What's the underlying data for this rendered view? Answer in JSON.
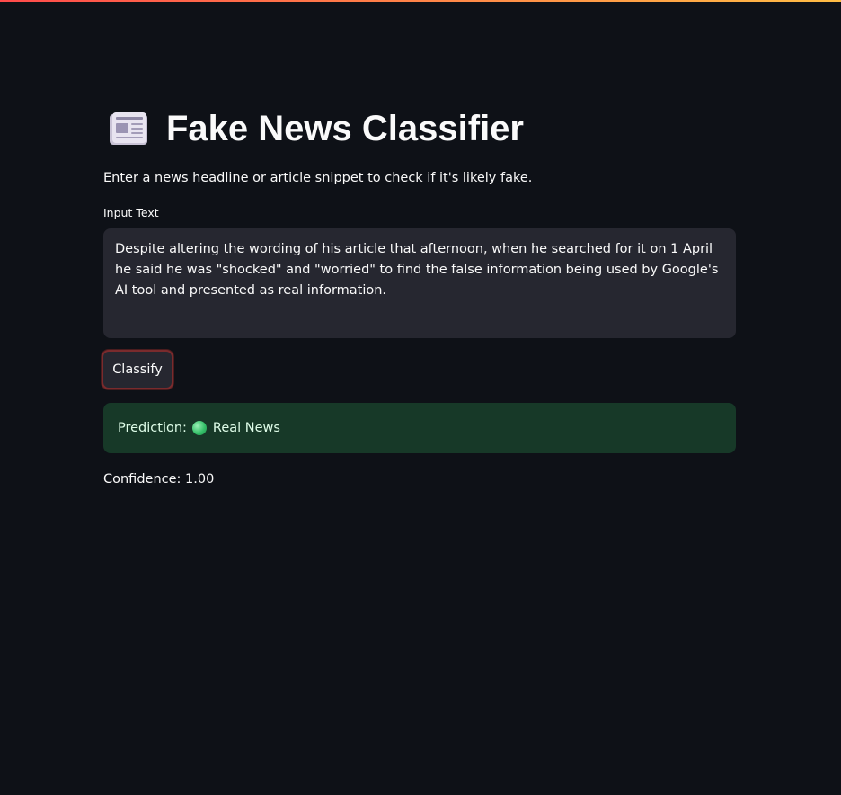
{
  "app": {
    "title": "Fake News Classifier",
    "title_icon": "newspaper-icon",
    "description": "Enter a news headline or article snippet to check if it's likely fake."
  },
  "input": {
    "label": "Input Text",
    "value": "Despite altering the wording of his article that afternoon, when he searched for it on 1 April he said he was \"shocked\" and \"worried\" to find the false information being used by Google's AI tool and presented as real information."
  },
  "actions": {
    "classify_label": "Classify"
  },
  "result": {
    "prediction_prefix": "Prediction:",
    "prediction_icon": "green-circle-icon",
    "prediction_value": "Real News",
    "confidence_text": "Confidence: 1.00"
  },
  "colors": {
    "background": "#0e1117",
    "accent_gradient_start": "#ff4b4b",
    "accent_gradient_end": "#ffbd45",
    "input_bg": "#262730",
    "success_bg": "#173928",
    "success_text": "#dffde9",
    "button_focus_border": "#7a2b2d"
  }
}
